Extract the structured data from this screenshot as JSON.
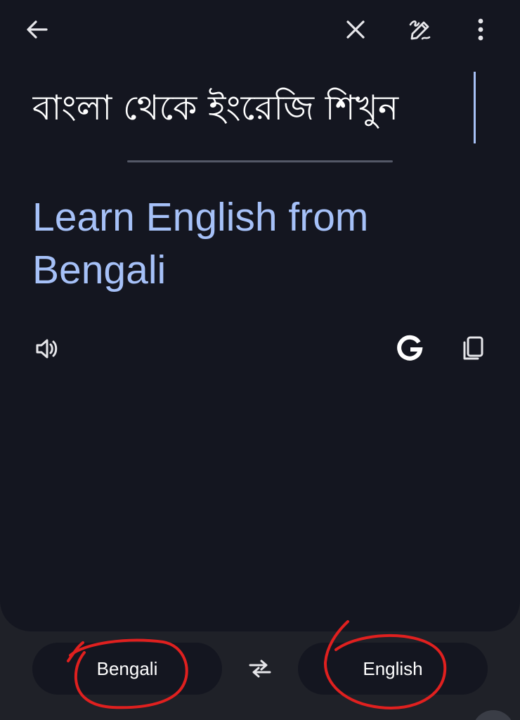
{
  "topbar": {
    "back_icon": "arrow-left-icon",
    "clear_icon": "close-icon",
    "handwriting_icon": "pen-handwriting-icon",
    "menu_icon": "more-vert-icon"
  },
  "source": {
    "text": "বাংলা থেকে ইংরেজি শিখুন"
  },
  "translation": {
    "text": "Learn English from Bengali"
  },
  "actions": {
    "speak_icon": "speaker-icon",
    "google_icon": "google-g-icon",
    "copy_icon": "copy-icon"
  },
  "languages": {
    "source": "Bengali",
    "target": "English",
    "swap_icon": "swap-arrows-icon"
  },
  "colors": {
    "background": "#1f2128",
    "card": "#141620",
    "translation_text": "#a6c1f8",
    "annotation": "#e0201f"
  }
}
